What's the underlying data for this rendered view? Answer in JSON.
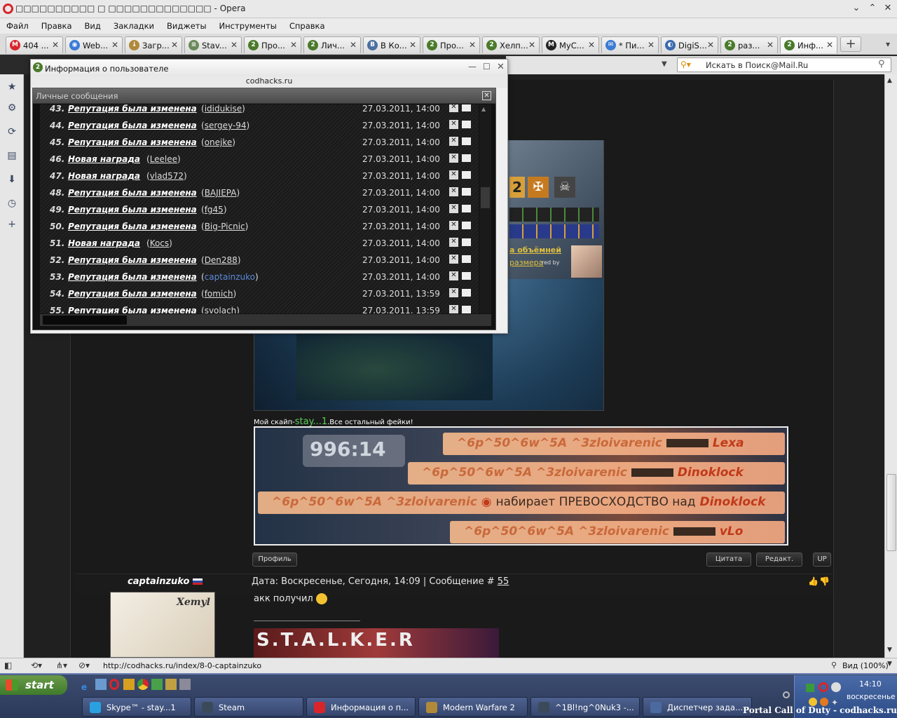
{
  "window": {
    "title": "Ѻѻѻѻѻѻѻѻѻ ѻ ѻѻѻѻѻѻѻѻѻѻѻѻ - Opera",
    "title_text": "□□□□□□□□□□ □ □□□□□□□□□□□□□ - Opera"
  },
  "menu": [
    "Файл",
    "Правка",
    "Вид",
    "Закладки",
    "Виджеты",
    "Инструменты",
    "Справка"
  ],
  "tabs": [
    {
      "label": "404 ...",
      "color": "#d8252b",
      "glyph": "M"
    },
    {
      "label": "Web...",
      "color": "#3a7bd5",
      "glyph": "◉"
    },
    {
      "label": "Загр...",
      "color": "#b08a3a",
      "glyph": "↓"
    },
    {
      "label": "Stav...",
      "color": "#6a8a5a",
      "glyph": "≡"
    },
    {
      "label": "Про...",
      "color": "#4a7a2a",
      "glyph": "2"
    },
    {
      "label": "Лич...",
      "color": "#4a7a2a",
      "glyph": "2"
    },
    {
      "label": "В Ко...",
      "color": "#4c6fa1",
      "glyph": "B"
    },
    {
      "label": "Про...",
      "color": "#4a7a2a",
      "glyph": "2"
    },
    {
      "label": "Хелп...",
      "color": "#4a7a2a",
      "glyph": "2"
    },
    {
      "label": "MyC...",
      "color": "#222222",
      "glyph": "M"
    },
    {
      "label": "* Пи...",
      "color": "#3a7bd5",
      "glyph": "✉"
    },
    {
      "label": "DigiS...",
      "color": "#3a6ab0",
      "glyph": "◐"
    },
    {
      "label": "раз...",
      "color": "#4a7a2a",
      "glyph": "2"
    },
    {
      "label": "Инф...",
      "color": "#4a7a2a",
      "glyph": "2"
    }
  ],
  "search": {
    "placeholder": "Искать в Поиск@Mail.Ru"
  },
  "popup": {
    "title": "Информация о пользователе",
    "site": "codhacks.ru",
    "pm_header": "Личные сообщения",
    "rows": [
      {
        "n": "43.",
        "text": "Репутация была изменена",
        "user": "ididukise",
        "date": "27.03.2011, 14:00"
      },
      {
        "n": "44.",
        "text": "Репутация была изменена",
        "user": "sergey-94",
        "date": "27.03.2011, 14:00"
      },
      {
        "n": "45.",
        "text": "Репутация была изменена",
        "user": "onejke",
        "date": "27.03.2011, 14:00"
      },
      {
        "n": "46.",
        "text": "Новая награда",
        "user": "Leelee",
        "date": "27.03.2011, 14:00"
      },
      {
        "n": "47.",
        "text": "Новая награда",
        "user": "vlad572",
        "date": "27.03.2011, 14:00"
      },
      {
        "n": "48.",
        "text": "Репутация была изменена",
        "user": "BAJIEPA",
        "date": "27.03.2011, 14:00"
      },
      {
        "n": "49.",
        "text": "Репутация была изменена",
        "user": "fg45",
        "date": "27.03.2011, 14:00"
      },
      {
        "n": "50.",
        "text": "Репутация была изменена",
        "user": "Big-Picnic",
        "date": "27.03.2011, 14:00"
      },
      {
        "n": "51.",
        "text": "Новая награда",
        "user": "Kocs",
        "date": "27.03.2011, 14:00"
      },
      {
        "n": "52.",
        "text": "Репутация была изменена",
        "user": "Den288",
        "date": "27.03.2011, 14:00"
      },
      {
        "n": "53.",
        "text": "Репутация была изменена",
        "user": "captainzuko",
        "date": "27.03.2011, 14:00"
      },
      {
        "n": "54.",
        "text": "Репутация была изменена",
        "user": "fomich",
        "date": "27.03.2011, 13:59"
      },
      {
        "n": "55.",
        "text": "Репутация была изменена",
        "user": "svolach",
        "date": "27.03.2011, 13:59"
      }
    ]
  },
  "page": {
    "skype_prefix": "Мой скайп-",
    "skype_name": "stay...1",
    "skype_suffix": ".Все остальный фейки!",
    "sig_link1": "а объёмней",
    "sig_link2": "размера",
    "sig_credit": "red by",
    "killfeed_score": "996:14",
    "killfeed": [
      {
        "attacker": "^6p^50^6w^5A ^3zloivarenic",
        "victim": "Lexa",
        "mid": ""
      },
      {
        "attacker": "^6p^50^6w^5A ^3zloivarenic",
        "victim": "Dinoklock",
        "mid": ""
      },
      {
        "attacker": "^6p^50^6w^5A ^3zloivarenic",
        "victim": "Dinoklock",
        "mid": "набирает ПРЕВОСХОДСТВО над"
      },
      {
        "attacker": "^6p^50^6w^5A ^3zloivarenic",
        "victim": "vLo",
        "mid": ""
      }
    ],
    "btn_profile": "Профиль",
    "btn_quote": "Цитата",
    "btn_edit": "Редакт.",
    "btn_up": "UP",
    "post_author": "captainzuko",
    "post_date": "Дата: Воскресенье, Сегодня, 14:09 | Сообщение # ",
    "post_num": "55",
    "post_text": "акк получил",
    "avatar_text": "Xemyl",
    "stalker_text": "S.T.A.L.K.E.R"
  },
  "status": {
    "url": "http://codhacks.ru/index/8-0-captainzuko",
    "zoom": "Вид (100%)"
  },
  "taskbar": {
    "start": "start",
    "items": [
      {
        "label": "Skype™ - stay...1",
        "color": "#2aa0e0"
      },
      {
        "label": "Steam",
        "color": "#3a4a5a"
      },
      {
        "label": "Информация о п...",
        "color": "#d8252b"
      },
      {
        "label": "Modern Warfare 2",
        "color": "#b08a3a"
      },
      {
        "label": "^1Bl!ng^0Nuk3 -...",
        "color": "#3a4a5a"
      },
      {
        "label": "Диспетчер зада...",
        "color": "#4a6aa0"
      }
    ],
    "clock": "14:10",
    "day": "воскресенье",
    "watermark": "Portal Call of Duty - codhacks.ru"
  }
}
